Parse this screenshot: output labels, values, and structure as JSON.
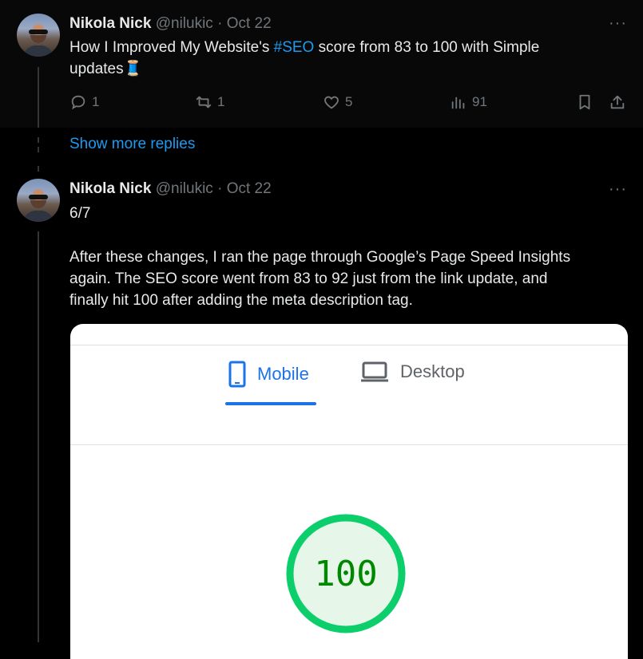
{
  "tweets": [
    {
      "author": {
        "name": "Nikola Nick",
        "handle": "@nilukic",
        "date": "Oct 22",
        "separator": "·"
      },
      "text_before": "How I Improved My Website's ",
      "hashtag": "#SEO",
      "text_after": " score from 83 to 100 with Simple",
      "text_line2": "updates🧵",
      "stats": {
        "replies": "1",
        "retweets": "1",
        "likes": "5",
        "views": "91"
      }
    },
    {
      "author": {
        "name": "Nikola Nick",
        "handle": "@nilukic",
        "date": "Oct 22",
        "separator": "·"
      },
      "counter": "6/7",
      "paragraph_lines": [
        "After these changes, I ran the page through Google’s Page Speed Insights",
        "again. The SEO score went from 83 to 92 just from the link update, and",
        "finally hit 100 after adding the meta description tag."
      ]
    }
  ],
  "thread": {
    "show_more_label": "Show more replies"
  },
  "more_glyph": "···",
  "image_card": {
    "tabs": [
      {
        "label": "Mobile",
        "icon": "phone-icon",
        "active": true
      },
      {
        "label": "Desktop",
        "icon": "laptop-icon",
        "active": false
      }
    ],
    "score": "100",
    "score_fraction": 1.0,
    "colors": {
      "accent": "#1a73e8",
      "score_ring": "#0cce6b",
      "score_fill": "#e6f7ea",
      "score_text": "#008800"
    }
  },
  "colors": {
    "link": "#1d9bf0",
    "muted": "#71767b",
    "text": "#e7e9ea"
  }
}
